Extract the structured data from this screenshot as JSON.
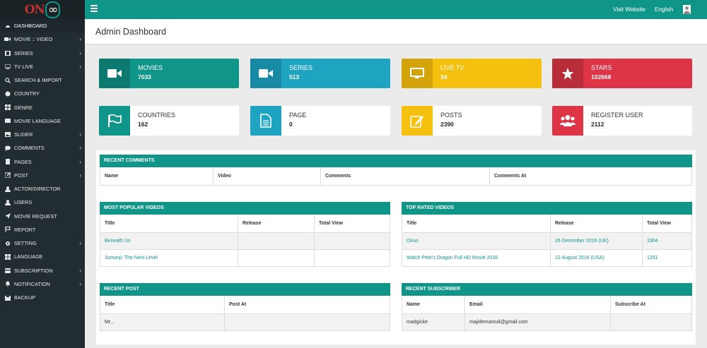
{
  "topbar": {
    "visit_website": "Visit Website",
    "language": "English"
  },
  "sidebar": {
    "items": [
      {
        "label": "DASHBOARD",
        "icon": "speedometer-icon",
        "has_children": false,
        "active": true
      },
      {
        "label": "MOVIE :: VIDEO",
        "icon": "video-icon",
        "has_children": true
      },
      {
        "label": "SERIES",
        "icon": "film-icon",
        "has_children": true
      },
      {
        "label": "TV LIVE",
        "icon": "tv-icon",
        "has_children": true
      },
      {
        "label": "SEARCH & IMPORT",
        "icon": "search-icon",
        "has_children": false
      },
      {
        "label": "COUNTRY",
        "icon": "globe-icon",
        "has_children": false
      },
      {
        "label": "GENRE",
        "icon": "grid-icon",
        "has_children": false
      },
      {
        "label": "MOVIE LANGUAGE",
        "icon": "language-icon",
        "has_children": false
      },
      {
        "label": "SLIDER",
        "icon": "image-icon",
        "has_children": true
      },
      {
        "label": "COMMENTS",
        "icon": "comment-icon",
        "has_children": true
      },
      {
        "label": "PAGES",
        "icon": "pages-icon",
        "has_children": true
      },
      {
        "label": "POST",
        "icon": "edit-icon",
        "has_children": true
      },
      {
        "label": "ACTOR/DIRECTOR",
        "icon": "user-icon",
        "has_children": false
      },
      {
        "label": "USERS",
        "icon": "users-icon",
        "has_children": false
      },
      {
        "label": "MOVIE REQUEST",
        "icon": "send-icon",
        "has_children": false
      },
      {
        "label": "REPORT",
        "icon": "flag-icon",
        "has_children": false
      },
      {
        "label": "SETTING",
        "icon": "gear-icon",
        "has_children": true
      },
      {
        "label": "LANGUAGE",
        "icon": "table-icon",
        "has_children": false
      },
      {
        "label": "SUBSCRIPTION",
        "icon": "card-icon",
        "has_children": true
      },
      {
        "label": "NOTIFICATION",
        "icon": "bell-icon",
        "has_children": true
      },
      {
        "label": "BACKUP",
        "icon": "database-icon",
        "has_children": false
      }
    ]
  },
  "header": {
    "title": "Admin Dashboard"
  },
  "stats": {
    "movies": {
      "label": "MOVIES",
      "value": "7033"
    },
    "series": {
      "label": "SERIES",
      "value": "513"
    },
    "livetv": {
      "label": "LIVE TV",
      "value": "34"
    },
    "stars": {
      "label": "STARS",
      "value": "102668"
    },
    "countries": {
      "label": "COUNTRIES",
      "value": "162"
    },
    "page": {
      "label": "PAGE",
      "value": "0"
    },
    "posts": {
      "label": "POSTS",
      "value": "2390"
    },
    "register_user": {
      "label": "REGISTER USER",
      "value": "2112"
    }
  },
  "colors": {
    "teal": "#0f9688",
    "teal_dark": "#0c7a6f",
    "cyan": "#1ea3c0",
    "cyan_dark": "#198aa3",
    "yellow": "#f5c10e",
    "yellow_dark": "#d2a40a",
    "red": "#dd3546",
    "red_dark": "#b92c3a",
    "sidebar": "#222d32"
  },
  "recent_comments": {
    "title": "RECENT COMMENTS",
    "columns": [
      "Name",
      "Video",
      "Comments",
      "Comments At"
    ]
  },
  "popular_videos": {
    "title": "MOST POPULAR VIDEOS",
    "columns": [
      "Title",
      "Release",
      "Total View"
    ],
    "rows": [
      [
        "Beneath Us",
        "",
        ""
      ],
      [
        "Jumanji: The Next Level",
        "",
        ""
      ]
    ]
  },
  "top_rated": {
    "title": "TOP RATED VIDEOS",
    "columns": [
      "Title",
      "Release",
      "Total View"
    ],
    "rows": [
      [
        "Onus",
        "26 December 2016 (UK)",
        "1904"
      ],
      [
        "Watch Pete's Dragon Full HD Movie 2016",
        "12 August 2016 (USA)",
        "1251"
      ]
    ]
  },
  "recent_post": {
    "title": "RECENT POST",
    "columns": [
      "Title",
      "Post At"
    ],
    "rows": [
      [
        "Mr...",
        ""
      ]
    ]
  },
  "recent_subscriber": {
    "title": "RECENT SUBSCRIBER",
    "columns": [
      "Name",
      "Email",
      "Subscribe At"
    ],
    "rows": [
      [
        "madgicke",
        "majidemarouli@gmail.com",
        ""
      ]
    ]
  }
}
